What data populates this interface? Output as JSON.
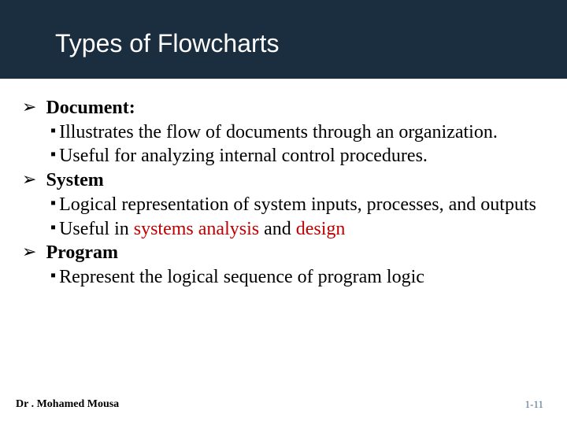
{
  "title": "Types of Flowcharts",
  "bullets": {
    "b1_label": "Document:",
    "b1_s1": "Illustrates the flow of documents through an organization.",
    "b1_s2": "Useful for analyzing internal control procedures.",
    "b2_label": "System",
    "b2_s1": "Logical representation of system inputs, processes, and outputs",
    "b2_s2_a": "Useful in ",
    "b2_s2_b": "systems analysis",
    "b2_s2_c": " and ",
    "b2_s2_d": "design",
    "b3_label": "Program",
    "b3_s1": "Represent the logical sequence of program logic"
  },
  "glyphs": {
    "arrow": "➢",
    "square": "▪"
  },
  "footer": {
    "author": "Dr . Mohamed Mousa",
    "page": "1-11"
  }
}
